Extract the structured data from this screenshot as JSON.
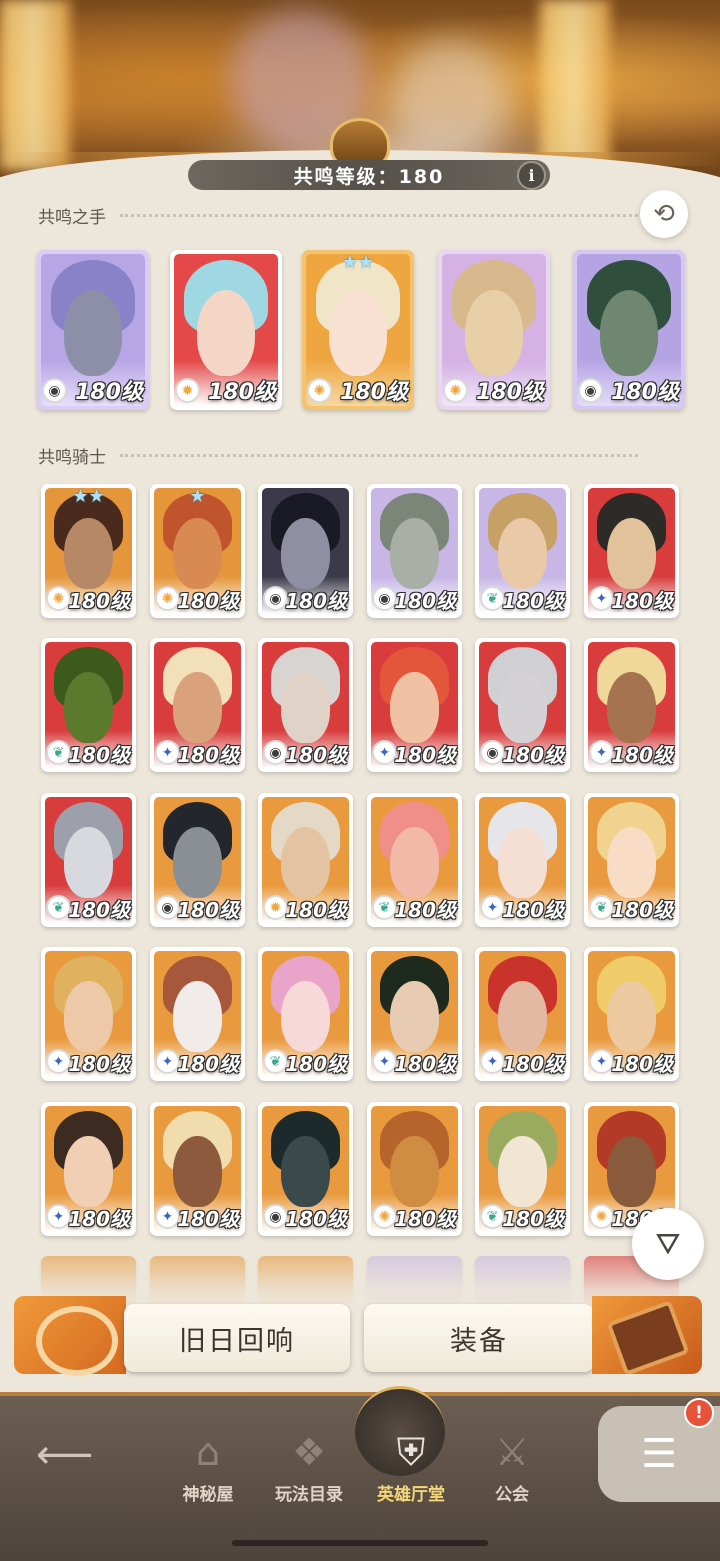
{
  "header": {
    "resonance_label": "共鸣等级：180",
    "info_icon": "i"
  },
  "sections": {
    "hands_title": "共鸣之手",
    "knights_title": "共鸣骑士"
  },
  "hands": [
    {
      "level": "180级",
      "faction": "forest",
      "bg": "#b7a6e6",
      "frame": "#d9ccf6",
      "face": "#8d8fa8",
      "hair": "#8a82c8",
      "stars": ""
    },
    {
      "level": "180级",
      "faction": "sun",
      "bg": "#e44848",
      "frame": "#ffffff",
      "face": "#f3d6c6",
      "hair": "#9fd8e2",
      "stars": ""
    },
    {
      "level": "180级",
      "faction": "lightbearer",
      "bg": "#f0a640",
      "frame": "#f3c36f",
      "face": "#f8e1d2",
      "hair": "#f1e5c8",
      "stars": "★★"
    },
    {
      "level": "180级",
      "faction": "lightbearer",
      "bg": "#d5b1e4",
      "frame": "#e8d6f2",
      "face": "#e9cfa7",
      "hair": "#d7b98d",
      "stars": ""
    },
    {
      "level": "180级",
      "faction": "forest",
      "bg": "#b5a4e4",
      "frame": "#d5c9f4",
      "face": "#6f8670",
      "hair": "#2f4e3b",
      "stars": ""
    }
  ],
  "knights": [
    {
      "level": "180级",
      "faction": "lightbearer",
      "bg": "#e5963b",
      "face": "#b78866",
      "hair": "#4a2a1c",
      "stars": "★★"
    },
    {
      "level": "180级",
      "faction": "lightbearer",
      "bg": "#e5963b",
      "face": "#d98a53",
      "hair": "#c0542c",
      "stars": "★"
    },
    {
      "level": "180级",
      "faction": "forest",
      "bg": "#3c3a4a",
      "face": "#8f8fa3",
      "hair": "#1a1a24",
      "stars": ""
    },
    {
      "level": "180级",
      "faction": "forest",
      "bg": "#c7b6e6",
      "face": "#a9aea7",
      "hair": "#7b8679",
      "stars": ""
    },
    {
      "level": "180级",
      "faction": "wilder",
      "bg": "#c7b6e6",
      "face": "#e9c9a8",
      "hair": "#c6a065",
      "stars": ""
    },
    {
      "level": "180级",
      "faction": "celestial",
      "bg": "#d83c3c",
      "face": "#e1c29a",
      "hair": "#2d2a28",
      "stars": ""
    },
    {
      "level": "180级",
      "faction": "wilder",
      "bg": "#d83c3c",
      "face": "#5c7a2e",
      "hair": "#3b5a1c",
      "stars": ""
    },
    {
      "level": "180级",
      "faction": "celestial",
      "bg": "#d83c3c",
      "face": "#d9a27c",
      "hair": "#f2e0b8",
      "stars": ""
    },
    {
      "level": "180级",
      "faction": "forest",
      "bg": "#d83c3c",
      "face": "#e1d2c8",
      "hair": "#d7d4d2",
      "stars": ""
    },
    {
      "level": "180级",
      "faction": "celestial",
      "bg": "#d83c3c",
      "face": "#f0c1a3",
      "hair": "#e4563c",
      "stars": ""
    },
    {
      "level": "180级",
      "faction": "forest",
      "bg": "#d83c3c",
      "face": "#d5d2d6",
      "hair": "#cfcfd4",
      "stars": ""
    },
    {
      "level": "180级",
      "faction": "celestial",
      "bg": "#d83c3c",
      "face": "#a57350",
      "hair": "#f0d89a",
      "stars": ""
    },
    {
      "level": "180级",
      "faction": "wilder",
      "bg": "#d83c3c",
      "face": "#d8d9de",
      "hair": "#9da0aa",
      "stars": ""
    },
    {
      "level": "180级",
      "faction": "forest",
      "bg": "#e99a3f",
      "face": "#8a8f96",
      "hair": "#23262c",
      "stars": ""
    },
    {
      "level": "180级",
      "faction": "sun",
      "bg": "#e99a3f",
      "face": "#e3c3a2",
      "hair": "#e4d9c6",
      "stars": ""
    },
    {
      "level": "180级",
      "faction": "wilder",
      "bg": "#e99a3f",
      "face": "#f2b8a8",
      "hair": "#f08f8a",
      "stars": ""
    },
    {
      "level": "180级",
      "faction": "celestial",
      "bg": "#e99a3f",
      "face": "#f5dfd3",
      "hair": "#e6e6ea",
      "stars": ""
    },
    {
      "level": "180级",
      "faction": "wilder",
      "bg": "#e99a3f",
      "face": "#f8dcc6",
      "hair": "#f0d38f",
      "stars": ""
    },
    {
      "level": "180级",
      "faction": "celestial",
      "bg": "#e99a3f",
      "face": "#edc9a8",
      "hair": "#e0b25f",
      "stars": ""
    },
    {
      "level": "180级",
      "faction": "celestial",
      "bg": "#e99a3f",
      "face": "#f1ecea",
      "hair": "#a7573b",
      "stars": ""
    },
    {
      "level": "180级",
      "faction": "wilder",
      "bg": "#e99a3f",
      "face": "#f6d9d8",
      "hair": "#e8a5c9",
      "stars": ""
    },
    {
      "level": "180级",
      "faction": "celestial",
      "bg": "#e99a3f",
      "face": "#e8cbb3",
      "hair": "#1f2a1f",
      "stars": ""
    },
    {
      "level": "180级",
      "faction": "celestial",
      "bg": "#e99a3f",
      "face": "#e4b9a4",
      "hair": "#c9332b",
      "stars": ""
    },
    {
      "level": "180级",
      "faction": "celestial",
      "bg": "#e99a3f",
      "face": "#edc9a2",
      "hair": "#f0cb6a",
      "stars": ""
    },
    {
      "level": "180级",
      "faction": "celestial",
      "bg": "#e99a3f",
      "face": "#f1cfb5",
      "hair": "#3d2b22",
      "stars": ""
    },
    {
      "level": "180级",
      "faction": "celestial",
      "bg": "#e99a3f",
      "face": "#8d5a3d",
      "hair": "#f1dcae",
      "stars": ""
    },
    {
      "level": "180级",
      "faction": "forest",
      "bg": "#e99a3f",
      "face": "#3a4a4c",
      "hair": "#1d2a2c",
      "stars": ""
    },
    {
      "level": "180级",
      "faction": "lightbearer",
      "bg": "#e99a3f",
      "face": "#d18c43",
      "hair": "#b5652c",
      "stars": ""
    },
    {
      "level": "180级",
      "faction": "wilder",
      "bg": "#e99a3f",
      "face": "#f1e6d3",
      "hair": "#9aaa5f",
      "stars": ""
    },
    {
      "level": "180级",
      "faction": "lightbearer",
      "bg": "#e99a3f",
      "face": "#8a5a3c",
      "hair": "#b33a26",
      "stars": ""
    }
  ],
  "faction_colors": {
    "lightbearer": "#f0a640",
    "sun": "#f3a93a",
    "forest": "#3c3c3c",
    "wilder": "#3aa88a",
    "celestial": "#3b66c4"
  },
  "actions": {
    "echoes_label": "旧日回响",
    "equipment_label": "装备"
  },
  "nav": {
    "items": [
      {
        "label": "神秘屋",
        "icon": "mystery-house-icon"
      },
      {
        "label": "玩法目录",
        "icon": "game-modes-icon"
      },
      {
        "label": "英雄厅堂",
        "icon": "hero-hall-icon"
      },
      {
        "label": "公会",
        "icon": "guild-icon"
      }
    ],
    "active_index": 2,
    "menu_badge": "!"
  }
}
